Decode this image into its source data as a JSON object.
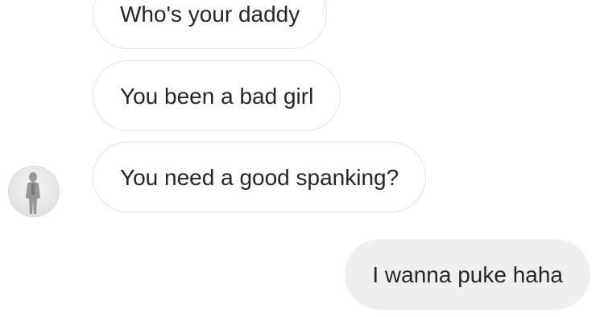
{
  "conversation": {
    "received": [
      {
        "text": "Who's your daddy"
      },
      {
        "text": "You been a bad girl"
      },
      {
        "text": "You need a good spanking?"
      }
    ],
    "sent": [
      {
        "text": "I wanna puke haha"
      }
    ]
  },
  "sender": {
    "avatar_icon": "person-photo-avatar"
  },
  "colors": {
    "incoming_bubble_bg": "#ffffff",
    "incoming_bubble_border": "#e2e2e2",
    "outgoing_bubble_bg": "#efefef",
    "text": "#262626"
  }
}
